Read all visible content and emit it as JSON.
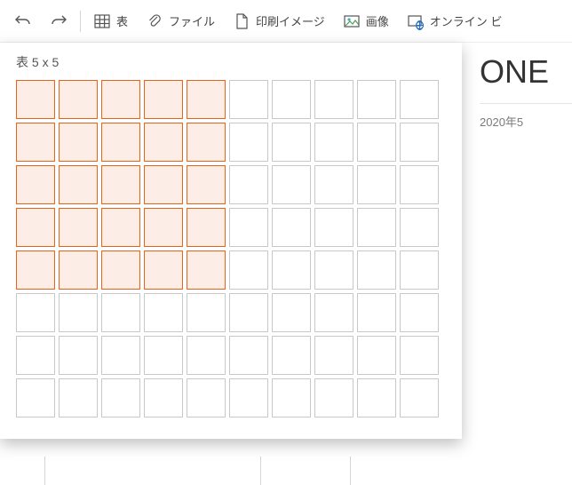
{
  "ribbon": {
    "undo": "",
    "redo": "",
    "table": "表",
    "file": "ファイル",
    "print": "印刷イメージ",
    "image": "画像",
    "onlinevideo": "オンライン ビ"
  },
  "dropdown": {
    "title": "表 5 x 5",
    "selected_rows": 5,
    "selected_cols": 5,
    "total_rows": 8,
    "total_cols": 10
  },
  "page": {
    "title": "ONE",
    "date": "2020年5"
  }
}
